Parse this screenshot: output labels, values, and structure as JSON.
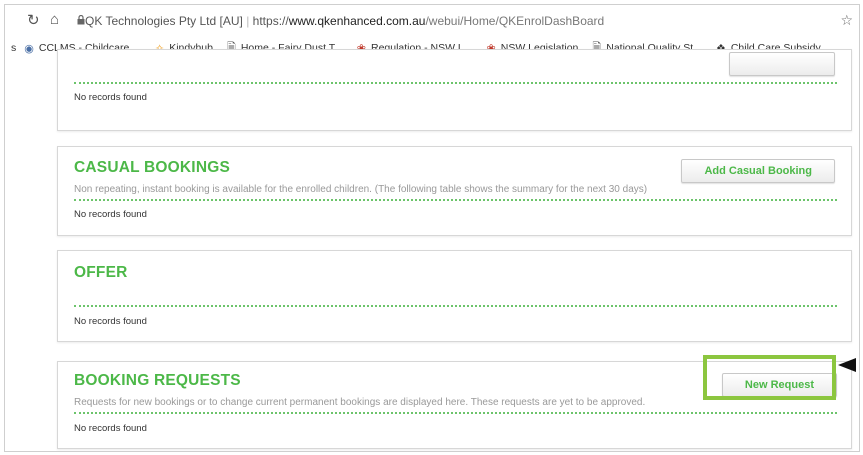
{
  "browser": {
    "site_identity": "QK Technologies Pty Ltd [AU]",
    "url_prefix": "https://",
    "url_host": "www.qkenhanced.com.au",
    "url_path": "/webui/Home/QKEnrolDashBoard",
    "bookmarks": [
      {
        "icon": "cclms-icon",
        "label": "CCLMS - Childcare ..."
      },
      {
        "icon": "kindyhub-icon",
        "label": "Kindyhub"
      },
      {
        "icon": "page-icon",
        "label": "Home - Fairy Dust T..."
      },
      {
        "icon": "nsw-icon",
        "label": "Regulation - NSW L..."
      },
      {
        "icon": "nsw-icon",
        "label": "NSW Legislation"
      },
      {
        "icon": "page-icon",
        "label": "National Quality St..."
      },
      {
        "icon": "ccs-icon",
        "label": "Child Care Subsidy ..."
      }
    ]
  },
  "panels": {
    "top": {
      "empty": "No records found"
    },
    "casual": {
      "title": "CASUAL BOOKINGS",
      "desc": "Non repeating, instant booking is available for the enrolled children. (The following table shows the summary for the next 30 days)",
      "button": "Add Casual Booking",
      "empty": "No records found"
    },
    "offer": {
      "title": "OFFER",
      "empty": "No records found"
    },
    "requests": {
      "title": "BOOKING REQUESTS",
      "desc": "Requests for new bookings or to change current permanent bookings are displayed here. These requests are yet to be approved.",
      "button": "New Request",
      "empty": "No records found"
    }
  },
  "colors": {
    "accent": "#4cb848",
    "highlight": "#8cc63f"
  }
}
